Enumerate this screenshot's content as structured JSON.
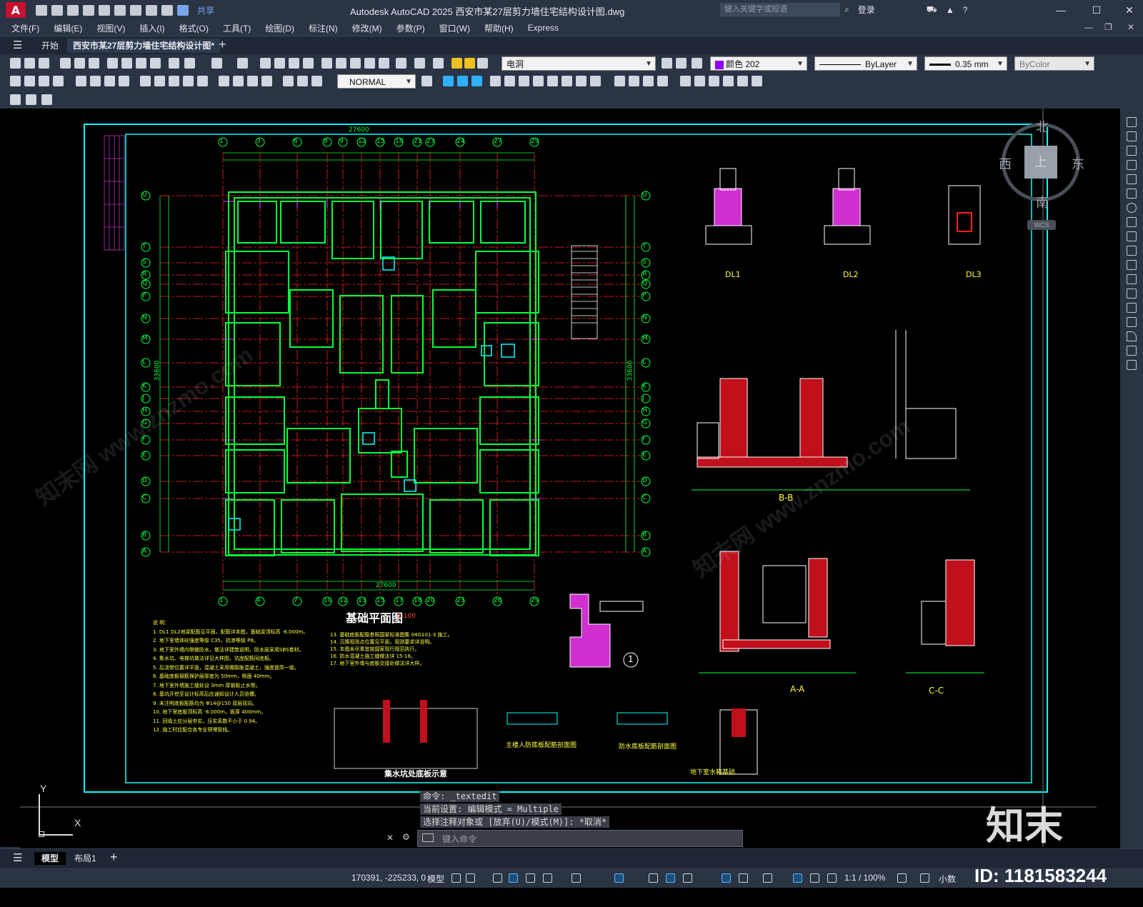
{
  "titlebar": {
    "logo": "A",
    "share_label": "共享",
    "title": "Autodesk AutoCAD 2025    西安市某27层剪力墙住宅结构设计图.dwg",
    "search_placeholder": "键入关键字或短语",
    "login_label": "登录"
  },
  "menu": [
    "文件(F)",
    "编辑(E)",
    "视图(V)",
    "插入(I)",
    "格式(O)",
    "工具(T)",
    "绘图(D)",
    "标注(N)",
    "修改(M)",
    "参数(P)",
    "窗口(W)",
    "帮助(H)",
    "Express"
  ],
  "tabs": {
    "start": "开始",
    "document": "西安市某27层剪力墙住宅结构设计图*"
  },
  "toolbar": {
    "layer_name": "电洞",
    "color_value": "颜色 202",
    "linetype_value": "ByLayer",
    "lineweight_value": "0.35 mm",
    "plotstyle_value": "ByColor",
    "style_value": "NORMAL"
  },
  "drawing": {
    "top_axis_labels": [
      "1",
      "2",
      "3",
      "5",
      "6",
      "7",
      "8",
      "9",
      "11",
      "12",
      "14",
      "15",
      "16",
      "18",
      "19",
      "21",
      "22",
      "23",
      "24",
      "25",
      "27",
      "28",
      "29"
    ],
    "top_dims": [
      "100",
      "900",
      "2100",
      "1200",
      "1500",
      "900",
      "2100",
      "1800",
      "2100",
      "1500",
      "1200",
      "2100",
      "2400",
      "2100",
      "1200",
      "2100",
      "1200",
      "2100",
      "1800",
      "2100",
      "900",
      "1500",
      "1200",
      "2100",
      "900",
      "100"
    ],
    "top_total": "27600",
    "bottom_axis_labels": [
      "1",
      "4",
      "7",
      "10",
      "12",
      "13",
      "15",
      "17",
      "18",
      "20",
      "23",
      "26",
      "29"
    ],
    "bottom_dims": [
      "100",
      "3300",
      "3300",
      "1800",
      "1800",
      "1800",
      "3000",
      "3300",
      "3300",
      "100"
    ],
    "bottom_total": "27600",
    "left_axis_labels": [
      "U",
      "T",
      "S",
      "R",
      "Q",
      "P",
      "N",
      "M",
      "L",
      "K",
      "J",
      "H",
      "G",
      "F",
      "E",
      "D",
      "C",
      "B",
      "A"
    ],
    "right_axis_labels": [
      "U",
      "T",
      "S",
      "R",
      "Q",
      "P",
      "N",
      "M",
      "L",
      "K",
      "J",
      "H",
      "G",
      "F",
      "E",
      "D",
      "C",
      "B",
      "A"
    ],
    "left_total": "33600",
    "right_total": "33600",
    "plan_title": "基础平面图",
    "plan_scale": "1:100",
    "section_dl1": "DL1",
    "section_dl2": "DL2",
    "section_dl3": "DL3",
    "section_bb": "B-B",
    "section_aa": "A-A",
    "section_cc": "C-C",
    "detail_pit": "集水坑处底板示意",
    "detail_civil_defense": "主楼人防底板配筋剖面图",
    "detail_waterproof": "防水底板配筋剖面图",
    "detail_basement": "地下室水箱基础",
    "circle_1": "1",
    "notes_title": "说 明：",
    "notes_left": [
      "1. DL1 DL2地梁配筋见平面，配筋详本图，基础梁顶标高 -6.000m。",
      "2. 地下室墙体砼强度等级 C35，抗渗等级 P8。",
      "3. 地下室外墙内侧做防水，做法详建筑说明，防水层采用SBS卷材。",
      "4. 集水坑、电梯坑做法详见大样图，坑底配筋同底板。",
      "5. 后浇带位置详平面，混凝土采用微膨胀混凝土，强度提高一级。",
      "6. 基础底板钢筋保护层厚度为 50mm，侧面 40mm。",
      "7. 地下室外墙施工缝处设 3mm 厚钢板止水带。",
      "8. 基坑开挖至设计标高后应通知设计人员验槽。",
      "9. 未注明底板配筋均为 Φ14@150 双层双向。",
      "10. 地下室底板顶标高 -6.000m，板厚 400mm。",
      "11. 回填土应分层夯实，压实系数不小于 0.94。",
      "12. 施工时应配合各专业预埋管线。"
    ],
    "notes_right": [
      "13. 基础底板配筋参照国家标准图集 04G101-3 施工。",
      "14. 沉降观测点位置见平面，观测要求详说明。",
      "15. 本图未尽事宜按国家现行规范执行。",
      "16. 防水混凝土施工缝做法详 15-18。",
      "17. 地下室外墙与底板交接处做法详大样。"
    ]
  },
  "command": {
    "line1": "命令: _textedit",
    "line2": "当前设置: 编辑模式 = Multiple",
    "line3": "选择注释对象或 [放弃(U)/模式(M)]: *取消*",
    "input_placeholder": "键入命令"
  },
  "viewcube": {
    "north": "北",
    "south": "南",
    "east": "东",
    "west": "西",
    "top": "上",
    "wcs": "WCS"
  },
  "ucs": {
    "y": "Y",
    "x": "X"
  },
  "layout_tabs": {
    "model": "模型",
    "layout1": "布局1"
  },
  "status": {
    "coords": "170391, -225233, 0",
    "model": "模型",
    "scale": "1:1 / 100%",
    "units": "小数"
  },
  "watermark": {
    "text": "知末网 www.znzmo.com",
    "logo": "知末",
    "id": "ID: 1181583244"
  },
  "colors": {
    "wall": "#00ff3c",
    "axis": "#ff2020",
    "frame": "#00ffff",
    "text": "#ffff40",
    "rebar": "#ff2040",
    "hatch": "#ff40ff"
  }
}
